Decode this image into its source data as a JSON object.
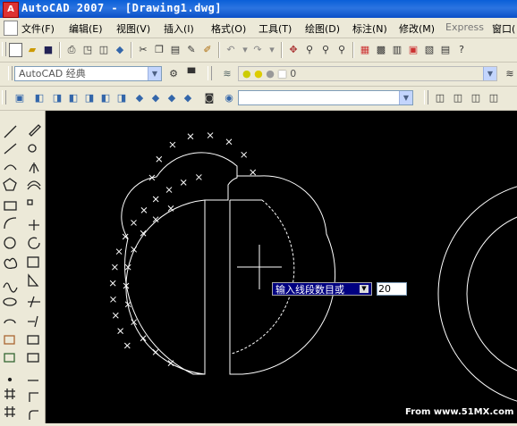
{
  "window": {
    "title": "AutoCAD 2007 - [Drawing1.dwg]",
    "app_icon_letter": "A"
  },
  "menu": {
    "items": [
      "文件(F)",
      "编辑(E)",
      "视图(V)",
      "插入(I)",
      "格式(O)",
      "工具(T)",
      "绘图(D)",
      "标注(N)",
      "修改(M)",
      "Express",
      "窗口("
    ]
  },
  "toolbar2": {
    "workspace": "AutoCAD 经典",
    "layer_value": "0"
  },
  "canvas": {
    "dynamic_prompt": "输入线段数目或",
    "dynamic_input": "20",
    "watermark": "From www.51MX.com"
  },
  "colors": {
    "canvas": "#000000",
    "prompt_bg": "#000080",
    "title_bar": "#0a5fd8"
  }
}
